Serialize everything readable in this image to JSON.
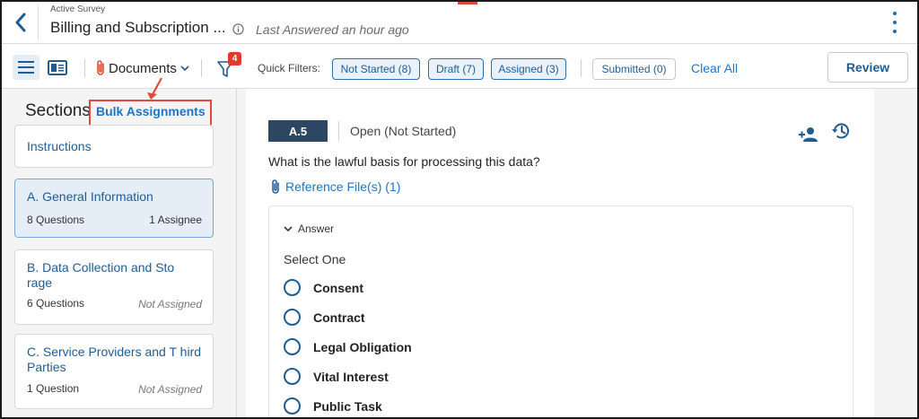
{
  "header": {
    "survey_label": "Active Survey",
    "title": "Billing and Subscription ...",
    "last_answered": "Last Answered an hour ago"
  },
  "toolbar": {
    "documents_label": "Documents",
    "filter_count": "4",
    "quick_filters_label": "Quick Filters:",
    "chips": [
      {
        "label": "Not Started (8)"
      },
      {
        "label": "Draft (7)"
      },
      {
        "label": "Assigned (3)"
      },
      {
        "label": "Submitted (0)"
      }
    ],
    "clear_all": "Clear All",
    "review": "Review"
  },
  "sidebar": {
    "title": "Sections",
    "bulk_assignments": "Bulk Assignments",
    "sections": [
      {
        "name": "Instructions"
      },
      {
        "name": "A. General Information",
        "count": "8 Questions",
        "assignee": "1 Assignee"
      },
      {
        "name": "B. Data Collection and Sto rage",
        "count": "6 Questions",
        "assignee": "Not Assigned"
      },
      {
        "name": "C. Service Providers and T hird Parties",
        "count": "1 Question",
        "assignee": "Not Assigned"
      }
    ]
  },
  "question": {
    "id": "A.5",
    "status": "Open (Not Started)",
    "text": "What is the lawful basis for processing this data?",
    "reference_files": "Reference File(s) (1)",
    "answer_label": "Answer",
    "select_prompt": "Select One",
    "options": [
      "Consent",
      "Contract",
      "Legal Obligation",
      "Vital Interest",
      "Public Task"
    ]
  },
  "colors": {
    "accent": "#1f74c4",
    "badge_bg": "#2d4763",
    "highlight_red": "#e04a3a",
    "selected_bg": "#e5eef7"
  }
}
